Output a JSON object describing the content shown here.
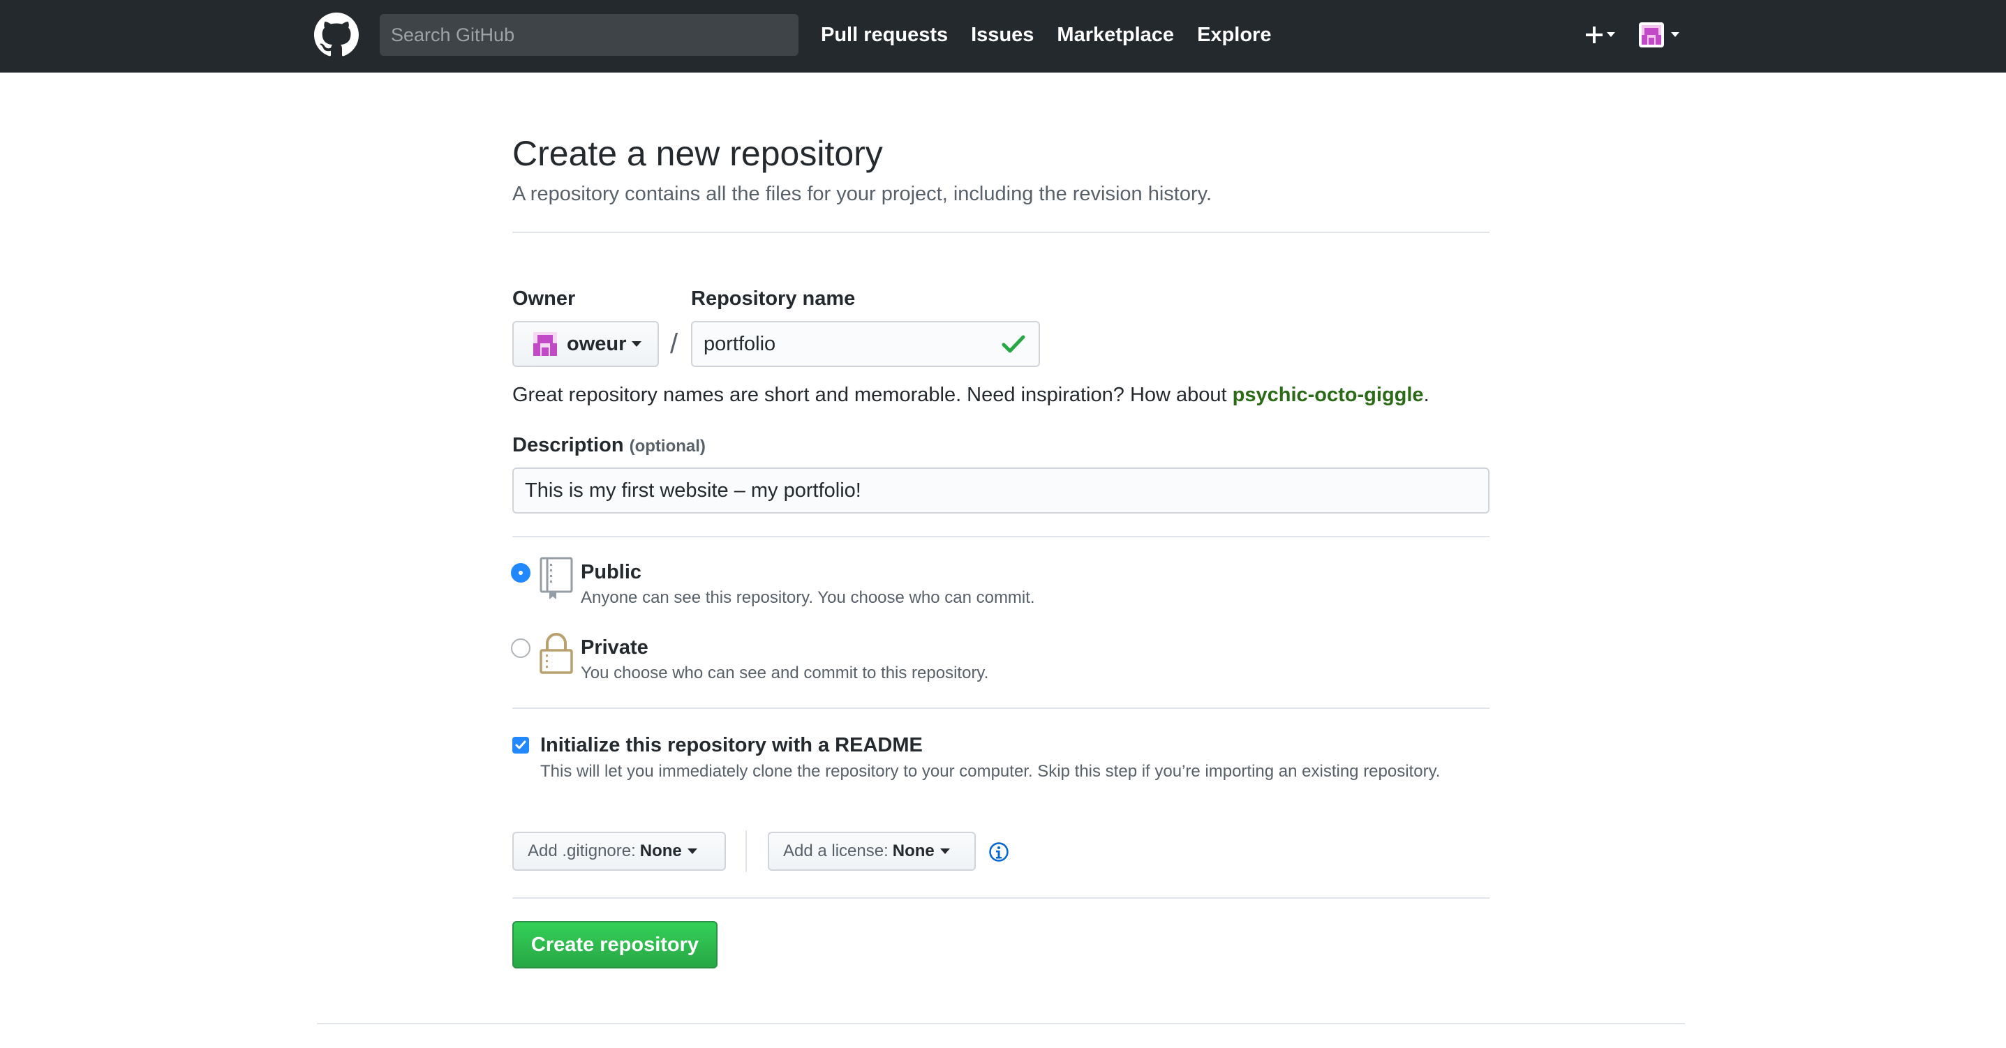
{
  "header": {
    "search_placeholder": "Search GitHub",
    "nav": [
      "Pull requests",
      "Issues",
      "Marketplace",
      "Explore"
    ],
    "icons": {
      "logo": "github-logo-icon",
      "plus": "plus-icon",
      "avatar": "user-avatar-icon"
    }
  },
  "page": {
    "title": "Create a new repository",
    "subtitle": "A repository contains all the files for your project, including the revision history."
  },
  "form": {
    "owner_label": "Owner",
    "owner_value": "oweur",
    "slash": "/",
    "repo_label": "Repository name",
    "repo_value": "portfolio",
    "hint_prefix": "Great repository names are short and memorable. Need inspiration? How about ",
    "hint_suggestion": "psychic-octo-giggle",
    "hint_suffix": ".",
    "description_label": "Description",
    "description_optional": "(optional)",
    "description_value": "This is my first website – my portfolio!",
    "visibility": {
      "public_title": "Public",
      "public_desc": "Anyone can see this repository. You choose who can commit.",
      "private_title": "Private",
      "private_desc": "You choose who can see and commit to this repository.",
      "selected": "Public"
    },
    "readme": {
      "checked": true,
      "title": "Initialize this repository with a README",
      "desc": "This will let you immediately clone the repository to your computer. Skip this step if you’re importing an existing repository."
    },
    "gitignore_label": "Add .gitignore:",
    "gitignore_value": "None",
    "license_label": "Add a license:",
    "license_value": "None",
    "submit_label": "Create repository"
  },
  "colors": {
    "header_bg": "#24292e",
    "primary_green": "#28a745",
    "link_green": "#2b6a17",
    "radio_blue": "#2188ff",
    "private_icon": "#b8a16f"
  }
}
